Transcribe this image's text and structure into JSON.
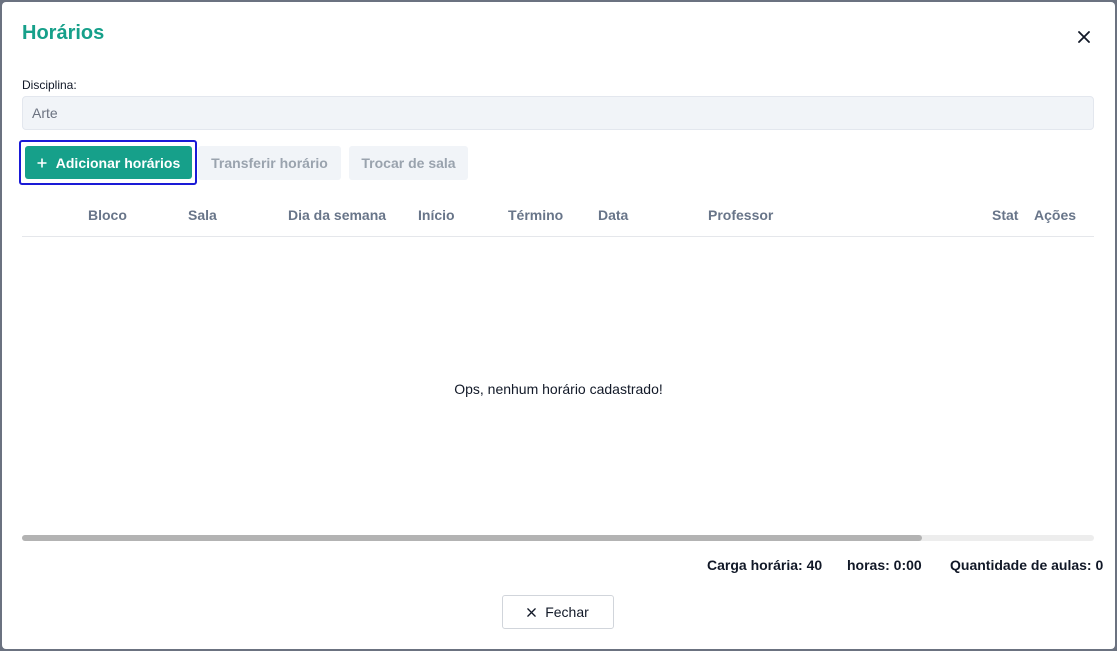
{
  "modal": {
    "title": "Horários"
  },
  "discipline": {
    "label": "Disciplina:",
    "value": "Arte"
  },
  "actions": {
    "add_label": "Adicionar horários",
    "transfer_label": "Transferir horário",
    "swap_room_label": "Trocar de sala"
  },
  "table": {
    "headers": [
      "Bloco",
      "Sala",
      "Dia da semana",
      "Início",
      "Término",
      "Data",
      "Professor",
      "Stat",
      "Ações"
    ],
    "empty_message": "Ops, nenhum horário cadastrado!",
    "scroll_fraction": 0.84
  },
  "footer": {
    "workload": "Carga horária: 40",
    "hours": "horas: 0:00",
    "lesson_count": "Quantidade de aulas: 0",
    "close_label": "Fechar"
  },
  "colors": {
    "accent": "#16a08a",
    "focus_outline": "#1a1ad6"
  },
  "icons": {
    "close": "close-icon",
    "add": "plus-icon"
  }
}
